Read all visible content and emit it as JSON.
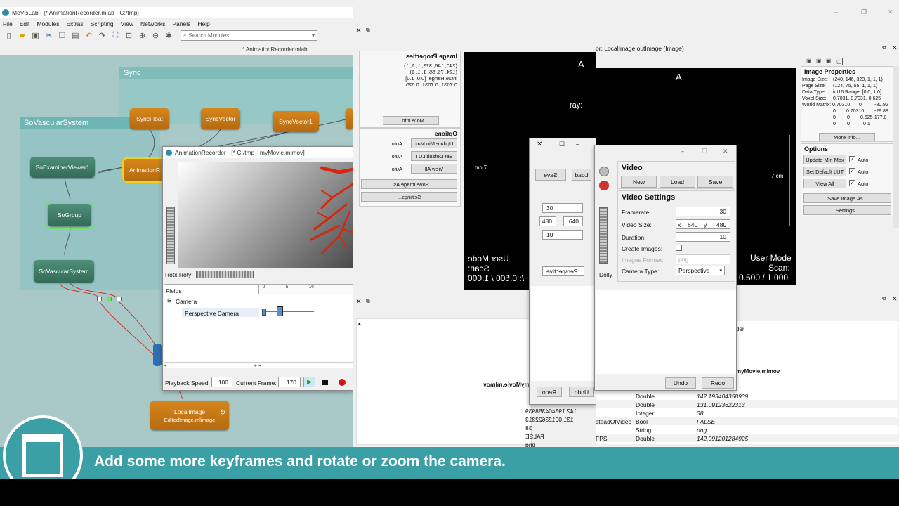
{
  "app": {
    "title": "MeVisLab - [* AnimationRecorder.mlab - C:/tmp]",
    "menu": [
      "File",
      "Edit",
      "Modules",
      "Extras",
      "Scripting",
      "View",
      "Networks",
      "Panels",
      "Help"
    ],
    "search_placeholder": "Search Modules",
    "network_tab": "* AnimationRecorder.mlab"
  },
  "network": {
    "group_sync": "Sync",
    "group_vascular": "SoVascularSystem",
    "nodes": {
      "sync_float": "SyncFloat",
      "sync_vector": "SyncVector",
      "sync_vector1": "SyncVector1",
      "examiner": "SoExaminerViewer1",
      "animation": "AnimationR",
      "sogroup": "SoGroup",
      "vascular": "SoVascularSystem",
      "localimage": "LocalImage",
      "localimage_sub": "EditedImage.mlimage"
    }
  },
  "recorder": {
    "title": "AnimationRecorder - [* C:/tmp - myMovie.mlmov]",
    "rot_label": "Rotx Roty",
    "fields_header": "Fields",
    "tree_camera": "Camera",
    "tree_perspective": "Perspective Camera",
    "ticks": [
      "0",
      "5",
      "10"
    ],
    "playback_label": "Playback Speed:",
    "playback_value": "100",
    "frame_label": "Current Frame:",
    "frame_value": "170"
  },
  "image_panel": {
    "title": "Image Properties",
    "rows": [
      [
        "Image Size:",
        "(240, 146, 323, 1, 1, 1)"
      ],
      [
        "Page Size:",
        "(124, 75, 55, 1, 1, 1)"
      ],
      [
        "Data Type:",
        "int16  Range: [0.0, 1.0]"
      ],
      [
        "Voxel Size:",
        "0.7031, 0.7031, 0.625"
      ]
    ],
    "matrix_label": "World Matrix:",
    "matrix": [
      [
        "0.70310",
        "0",
        "-80.92"
      ],
      [
        "0",
        "0.70310",
        "-29.88"
      ],
      [
        "0",
        "0",
        "0.625-177.8"
      ],
      [
        "0",
        "0",
        "0  1"
      ]
    ],
    "more_info": "More Info...",
    "options_title": "Options",
    "update_minmax": "Update Min Max",
    "set_default_lut": "Set Default LUT",
    "view_all": "View All",
    "auto": "Auto",
    "save_image_as": "Save Image As...",
    "settings": "Settings..."
  },
  "viewer_right": {
    "title": "or: LocalImage.outImage (Image)",
    "orientation": "A",
    "scale": "7 cm",
    "mode": "User Mode",
    "scan": "Scan:",
    "zoom": "/: 0.500 / 1.000"
  },
  "viewer_mirror": {
    "orientation": "A",
    "scale": "7 cm",
    "mode": "User Mode",
    "scan": "Scan:",
    "zoom": "/: 0.500 / 1.000",
    "array_text": "ray:"
  },
  "video_dialog": {
    "video_title": "Video",
    "new": "New",
    "load": "Load",
    "save": "Save",
    "settings_title": "Video Settings",
    "framerate_label": "Framerate:",
    "framerate": "30",
    "size_label": "Video Size:",
    "x_label": "x",
    "width": "640",
    "y_label": "y",
    "height": "480",
    "duration_label": "Duration:",
    "duration": "10",
    "create_images_label": "Create Images:",
    "images_format_label": "Images Format:",
    "images_format": "png",
    "camera_type_label": "Camera Type:",
    "camera_type": "Perspective",
    "undo": "Undo",
    "redo": "Redo",
    "dolly": "Dolly"
  },
  "mirror_dialog": {
    "load": "Load",
    "save": "Save",
    "framerate": "30",
    "width": "640",
    "height": "480",
    "duration": "10",
    "camera_type": "Perspective",
    "undo": "Undo",
    "redo": "Redo"
  },
  "table": {
    "header_right": "der",
    "title_right": "myMovie.mlmov",
    "title_mirror": "myMovie.mlmov",
    "rows": [
      [
        "",
        "Double",
        "142.193404358939"
      ],
      [
        "",
        "Double",
        "131.09123622313"
      ],
      [
        "",
        "Integer",
        "38"
      ],
      [
        "steadOfVideo",
        "Bool",
        "FALSE"
      ],
      [
        "",
        "String",
        "png"
      ],
      [
        "FPS",
        "Double",
        "142.091201284925"
      ]
    ],
    "mirror_vals": [
      "142.193404358939",
      "131.09123622313",
      "38",
      "FALSE",
      "png"
    ]
  },
  "caption": "Add some more keyframes and rotate or zoom the camera.",
  "colors": {
    "teal_bar": "#3aa0a6",
    "node_orange": "#c8781a",
    "node_green": "#3f7d68",
    "selection_green": "#6fe35a",
    "selection_yellow": "#f0d020"
  }
}
